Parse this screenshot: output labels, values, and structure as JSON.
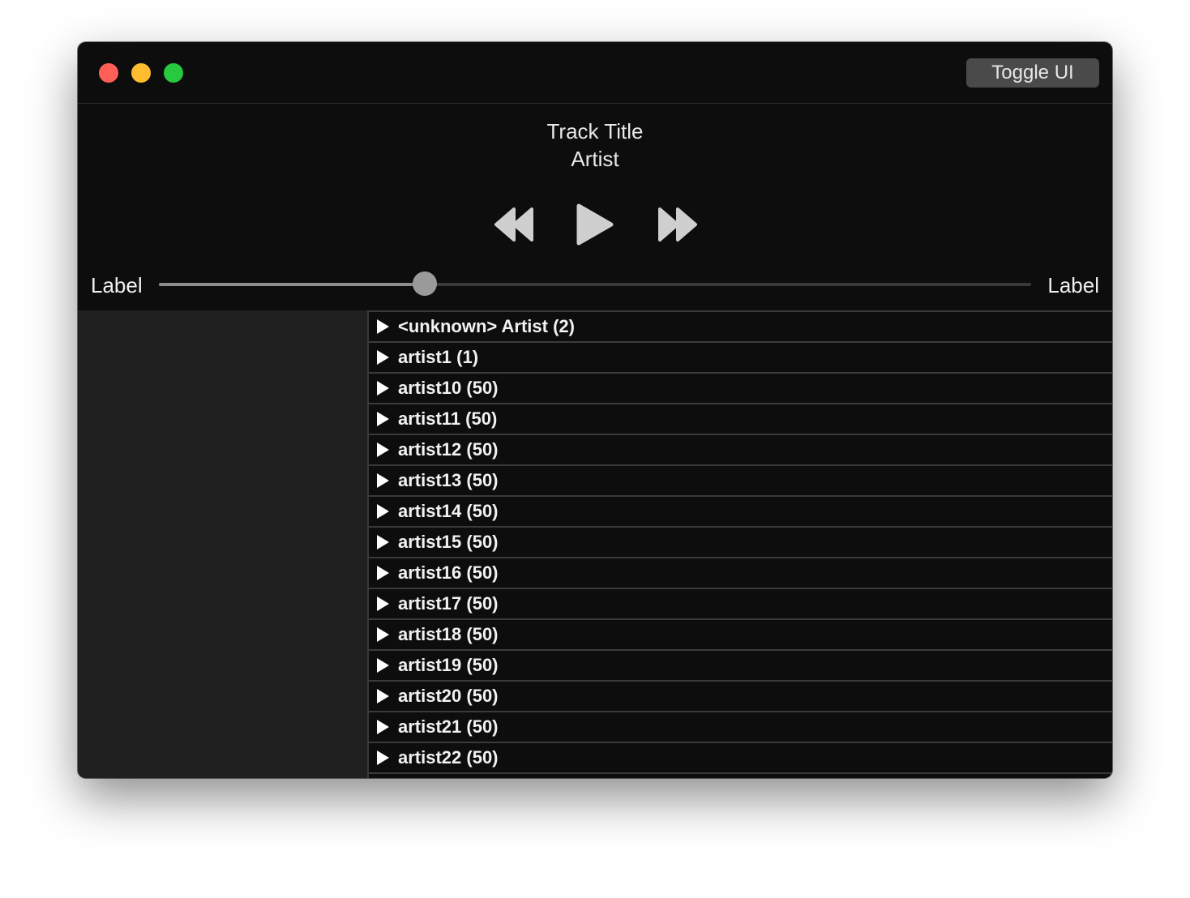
{
  "header": {
    "toggle_label": "Toggle UI"
  },
  "now_playing": {
    "title": "Track Title",
    "artist": "Artist"
  },
  "slider": {
    "label_left": "Label",
    "label_right": "Label",
    "value": 0.305
  },
  "library": {
    "items": [
      "<unknown> Artist (2)",
      "artist1 (1)",
      "artist10 (50)",
      "artist11 (50)",
      "artist12 (50)",
      "artist13 (50)",
      "artist14 (50)",
      "artist15 (50)",
      "artist16 (50)",
      "artist17 (50)",
      "artist18 (50)",
      "artist19 (50)",
      "artist20 (50)",
      "artist21 (50)",
      "artist22 (50)"
    ]
  },
  "colors": {
    "window_bg": "#0d0d0d",
    "sidebar_bg": "#202020",
    "control_icon": "#cfcfcf",
    "close": "#fe5f57",
    "minimize": "#febc2e",
    "maximize": "#28c840"
  }
}
